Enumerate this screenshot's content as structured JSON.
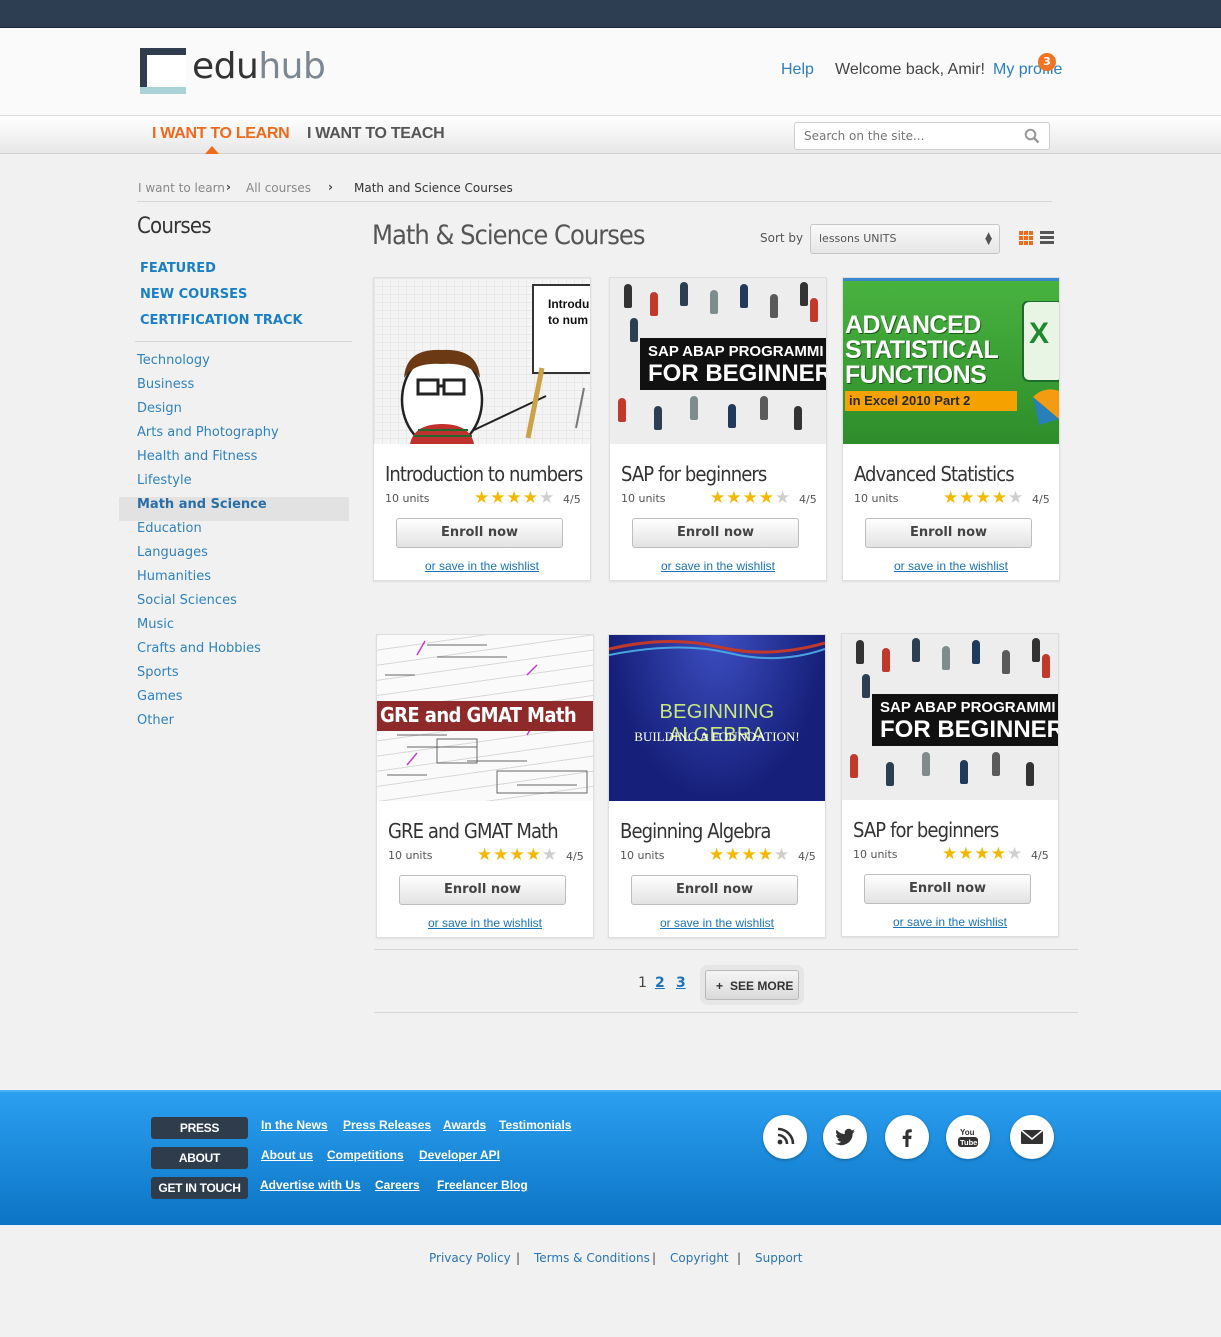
{
  "brand": {
    "logo_text_bold": "edu",
    "logo_text_light": "hub"
  },
  "header": {
    "help": "Help",
    "welcome": "Welcome back, Amir!",
    "profile": "My profile",
    "profile_badge": "3"
  },
  "nav": {
    "learn": "I WANT TO LEARN",
    "teach": "I WANT TO TEACH",
    "search_placeholder": "Search on the site..."
  },
  "breadcrumb": [
    "I want to learn",
    "All courses",
    "Math and Science Courses"
  ],
  "sidebar": {
    "title": "Courses",
    "featured_links": [
      "FEATURED",
      "NEW COURSES",
      "CERTIFICATION TRACK"
    ],
    "categories": [
      "Technology",
      "Business",
      "Design",
      "Arts and Photography",
      "Health and Fitness",
      "Lifestyle",
      "Math and Science",
      "Education",
      "Languages",
      "Humanities",
      "Social Sciences",
      "Music",
      "Crafts and Hobbies",
      "Sports",
      "Games",
      "Other"
    ],
    "active_category": "Math and Science"
  },
  "main": {
    "title": "Math & Science Courses",
    "sort_label": "Sort by",
    "sort_value": "lessons  UNITS"
  },
  "courses": [
    {
      "title": "Introduction to numbers",
      "units": "10 units",
      "rating": 4,
      "rating_text": "4/5",
      "enroll": "Enroll now",
      "wishlist": "or save in the wishlist",
      "thumb_text": [
        "Introdu",
        "to num"
      ]
    },
    {
      "title": "SAP for beginners",
      "units": "10 units",
      "rating": 4,
      "rating_text": "4/5",
      "enroll": "Enroll now",
      "wishlist": "or save in the wishlist",
      "thumb_text": [
        "SAP ABAP PROGRAMMI",
        "FOR BEGINNER"
      ]
    },
    {
      "title": "Advanced Statistics",
      "units": "10 units",
      "rating": 4,
      "rating_text": "4/5",
      "enroll": "Enroll now",
      "wishlist": "or save in the wishlist",
      "thumb_text": [
        "ADVANCED",
        "STATISTICAL",
        "FUNCTIONS",
        "in Excel 2010 Part 2"
      ]
    },
    {
      "title": "GRE and GMAT Math",
      "units": "10 units",
      "rating": 4,
      "rating_text": "4/5",
      "enroll": "Enroll now",
      "wishlist": "or save in the wishlist",
      "thumb_text": [
        "GRE and GMAT Math"
      ]
    },
    {
      "title": "Beginning Algebra",
      "units": "10 units",
      "rating": 4,
      "rating_text": "4/5",
      "enroll": "Enroll now",
      "wishlist": "or save in the wishlist",
      "thumb_text": [
        "BEGINNING ALGEBRA",
        "BUILDING A FOUNDATION!"
      ]
    },
    {
      "title": "SAP for beginners",
      "units": "10 units",
      "rating": 4,
      "rating_text": "4/5",
      "enroll": "Enroll now",
      "wishlist": "or save in the wishlist",
      "thumb_text": [
        "SAP ABAP PROGRAMMI",
        "FOR BEGINNER"
      ]
    }
  ],
  "pagination": {
    "pages": [
      "1",
      "2",
      "3"
    ],
    "current": "1",
    "see_more": "SEE MORE"
  },
  "footer": {
    "rows": [
      {
        "label": "PRESS",
        "links": [
          "In the News",
          "Press Releases",
          "Awards",
          "Testimonials"
        ]
      },
      {
        "label": "ABOUT",
        "links": [
          "About us",
          "Competitions",
          "Developer API"
        ]
      },
      {
        "label": "GET IN TOUCH",
        "links": [
          "Advertise with Us",
          "Careers",
          "Freelancer Blog"
        ]
      }
    ],
    "social_icons": [
      "rss-icon",
      "twitter-icon",
      "facebook-icon",
      "youtube-icon",
      "email-icon"
    ],
    "youtube_text": [
      "You",
      "Tube"
    ]
  },
  "bottom_links": [
    "Privacy Policy",
    "Terms & Conditions",
    "Copyright",
    "Support"
  ],
  "colors": {
    "accent": "#f06a1a",
    "link": "#1a7fc4",
    "topbar": "#2e3e52",
    "footer": "#1a8ad9"
  }
}
